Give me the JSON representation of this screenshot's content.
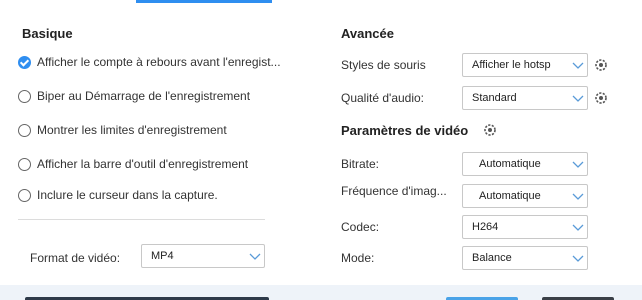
{
  "basique": {
    "title": "Basique",
    "options": [
      {
        "label": "Afficher le compte à rebours avant l'enregist...",
        "checked": true
      },
      {
        "label": "Biper au Démarrage de l'enregistrement",
        "checked": false
      },
      {
        "label": "Montrer les limites d'enregistrement",
        "checked": false
      },
      {
        "label": "Afficher la barre d'outil d'enregistrement",
        "checked": false
      },
      {
        "label": "Inclure le curseur dans la capture.",
        "checked": false
      }
    ],
    "format_label": "Format de vidéo:",
    "format_value": "MP4"
  },
  "avancee": {
    "title": "Avancée",
    "mouse_label": "Styles de souris",
    "mouse_value": "Afficher le hotsp",
    "audio_label": "Qualité d'audio:",
    "audio_value": "Standard"
  },
  "video": {
    "title": "Paramètres de vidéo",
    "bitrate_label": "Bitrate:",
    "bitrate_value": "Automatique",
    "fps_label": "Fréquence d'imag...",
    "fps_value": "Automatique",
    "codec_label": "Codec:",
    "codec_value": "H264",
    "mode_label": "Mode:",
    "mode_value": "Balance"
  },
  "colors": {
    "accent": "#2f8ef0",
    "footer_bg": "#eef3f9"
  }
}
